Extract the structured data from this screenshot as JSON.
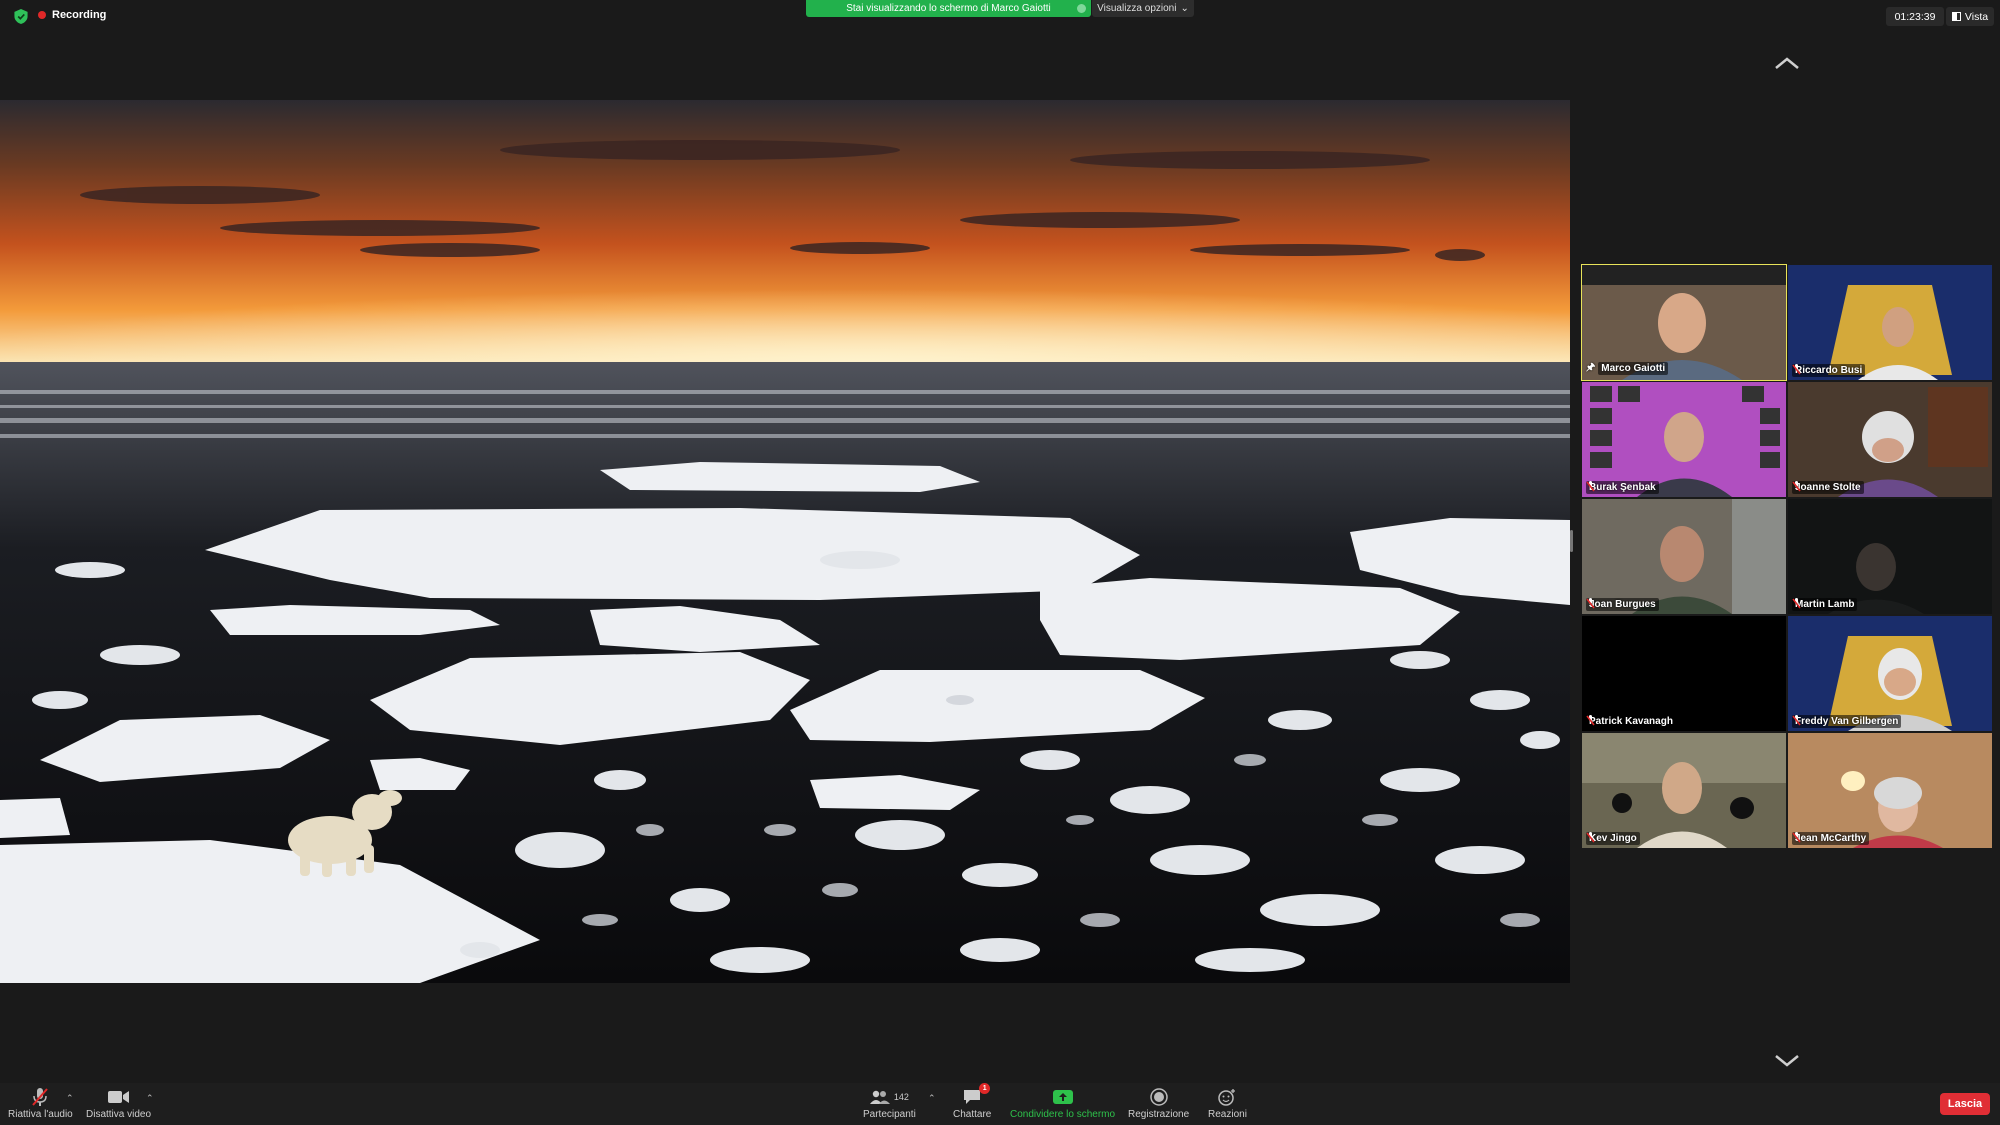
{
  "topbar": {
    "recording_label": "Recording",
    "share_banner": "Stai visualizzando lo schermo di Marco Gaiotti",
    "view_options": "Visualizza opzioni",
    "timer": "01:23:39",
    "view_label": "Vista"
  },
  "participants": [
    {
      "name": "Marco Gaiotti",
      "active": true,
      "bg": "#6b5a4a"
    },
    {
      "name": "Riccardo Busi",
      "active": false,
      "bg": "#1a2d6b"
    },
    {
      "name": "Burak Şenbak",
      "active": false,
      "bg": "#b04fc0"
    },
    {
      "name": "Joanne Stolte",
      "active": false,
      "bg": "#4a3a2e"
    },
    {
      "name": "Joan Burgues",
      "active": false,
      "bg": "#6f6a60"
    },
    {
      "name": "Martin Lamb",
      "active": false,
      "bg": "#121414"
    },
    {
      "name": "Patrick Kavanagh",
      "active": false,
      "bg": "#000000"
    },
    {
      "name": "Freddy Van Gilbergen",
      "active": false,
      "bg": "#1a2d6b"
    },
    {
      "name": "Kev Jingo",
      "active": false,
      "bg": "#6a6652"
    },
    {
      "name": "Jean McCarthy",
      "active": false,
      "bg": "#b88a60"
    }
  ],
  "toolbar": {
    "audio_label": "Riattiva l'audio",
    "video_label": "Disattiva video",
    "participants_label": "Partecipanti",
    "participants_count": "142",
    "chat_label": "Chattare",
    "chat_badge": "1",
    "share_label": "Condividere lo schermo",
    "record_label": "Registrazione",
    "reactions_label": "Reazioni",
    "leave_label": "Lascia"
  },
  "colors": {
    "share_green": "#22b14c",
    "leave_red": "#e02e35",
    "active_speaker": "#e8e35a"
  }
}
